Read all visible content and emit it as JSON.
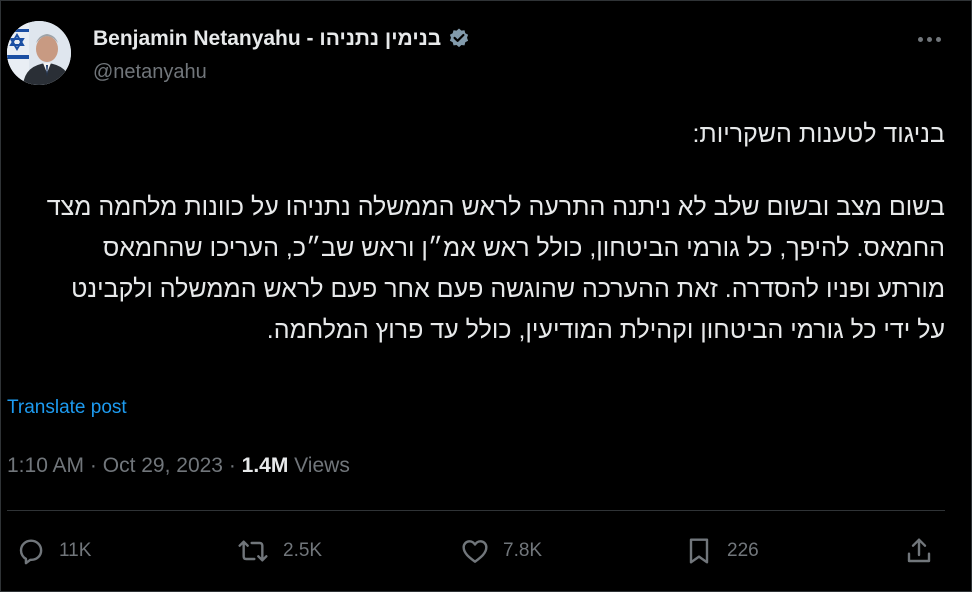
{
  "author": {
    "display_name": "Benjamin Netanyahu - בנימין נתניהו",
    "handle": "@netanyahu",
    "verified_icon": "verified-badge-icon"
  },
  "post": {
    "paragraphs": [
      "בניגוד לטענות השקריות:",
      "בשום מצב ובשום שלב לא ניתנה התרעה לראש הממשלה נתניהו על כוונות מלחמה מצד החמאס. להיפך, כל גורמי הביטחון, כולל ראש אמ״ן וראש שב״כ, העריכו שהחמאס מורתע ופניו להסדרה. זאת ההערכה שהוגשה פעם אחר פעם לראש הממשלה ולקבינט על ידי כל גורמי הביטחון וקהילת המודיעין, כולל עד פרוץ המלחמה."
    ],
    "translate_label": "Translate post"
  },
  "meta": {
    "time": "1:10 AM",
    "sep1": " · ",
    "date": "Oct 29, 2023",
    "sep2": " · ",
    "views_count": "1.4M",
    "views_label": " Views"
  },
  "actions": {
    "replies": "11K",
    "reposts": "2.5K",
    "likes": "7.8K",
    "bookmarks": "226"
  },
  "colors": {
    "background": "#000000",
    "text": "#e7e9ea",
    "muted": "#71767b",
    "link": "#1d9bf0",
    "divider": "#2f3336"
  }
}
